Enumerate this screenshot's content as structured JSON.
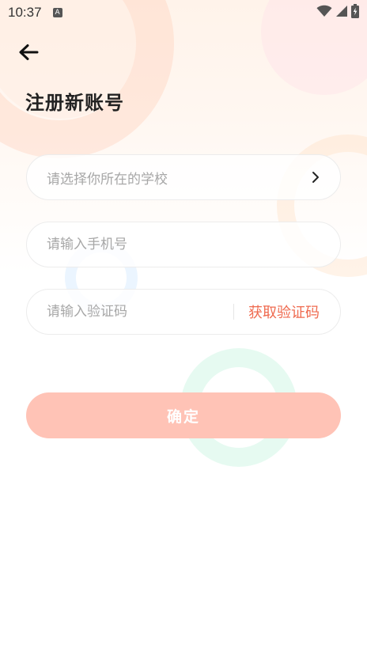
{
  "status_bar": {
    "time": "10:37",
    "app_icon_glyph": "A"
  },
  "page": {
    "title": "注册新账号"
  },
  "form": {
    "school": {
      "placeholder": "请选择你所在的学校"
    },
    "phone": {
      "placeholder": "请输入手机号"
    },
    "code": {
      "placeholder": "请输入验证码",
      "get_code_label": "获取验证码"
    },
    "confirm_label": "确定"
  },
  "colors": {
    "accent": "#ef6a4f",
    "button_disabled": "#ffc3b6",
    "title": "#222222",
    "placeholder": "#a7a7a7"
  },
  "icons": {
    "back": "arrow-left-icon",
    "school_select": "chevron-right-icon",
    "wifi": "wifi-icon",
    "cell": "cell-signal-icon",
    "battery": "battery-charging-icon"
  }
}
